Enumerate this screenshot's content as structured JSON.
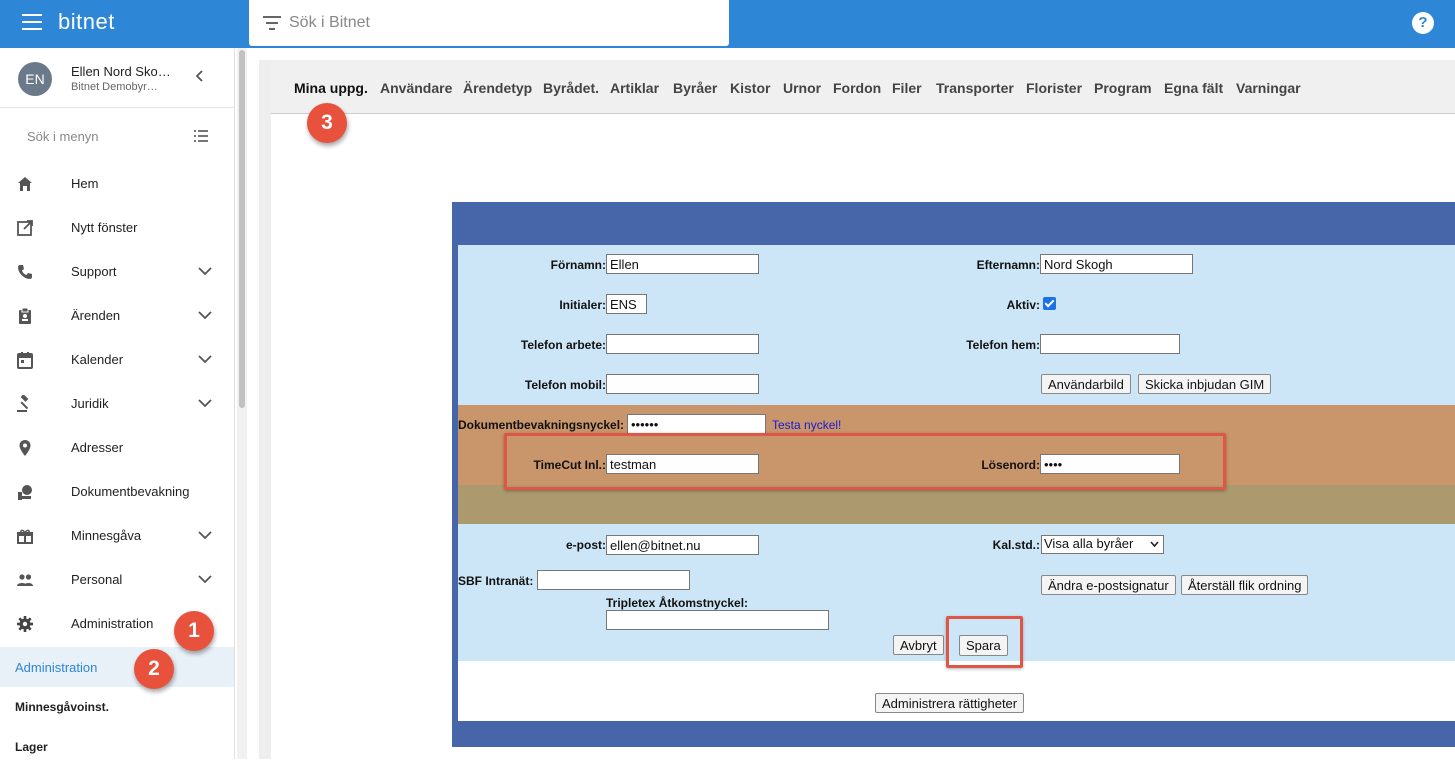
{
  "app": {
    "brand": "bitnet"
  },
  "search": {
    "placeholder": "Sök i Bitnet"
  },
  "user": {
    "initials": "EN",
    "name": "Ellen Nord Sko…",
    "org": "Bitnet Demobyr…"
  },
  "sidebar": {
    "menu_search": "Sök i menyn",
    "items": [
      {
        "label": "Hem",
        "icon": "home-icon",
        "chevron": false
      },
      {
        "label": "Nytt fönster",
        "icon": "open-new-window-icon",
        "chevron": false
      },
      {
        "label": "Support",
        "icon": "phone-icon",
        "chevron": true
      },
      {
        "label": "Ärenden",
        "icon": "clipboard-icon",
        "chevron": true
      },
      {
        "label": "Kalender",
        "icon": "calendar-icon",
        "chevron": true
      },
      {
        "label": "Juridik",
        "icon": "gavel-icon",
        "chevron": true
      },
      {
        "label": "Adresser",
        "icon": "location-pin-icon",
        "chevron": false
      },
      {
        "label": "Dokumentbevakning",
        "icon": "document-watch-icon",
        "chevron": false
      },
      {
        "label": "Minnesgåva",
        "icon": "gift-icon",
        "chevron": true
      },
      {
        "label": "Personal",
        "icon": "people-icon",
        "chevron": true
      },
      {
        "label": "Administration",
        "icon": "gear-icon",
        "chevron": false
      }
    ],
    "sub_items": [
      "Administration",
      "Minnesgåvoinst.",
      "Lager"
    ]
  },
  "tabs": [
    "Mina uppg.",
    "Användare",
    "Ärendetyp",
    "Byrådet.",
    "Artiklar",
    "Byråer",
    "Kistor",
    "Urnor",
    "Fordon",
    "Filer",
    "Transporter",
    "Florister",
    "Program",
    "Egna fält",
    "Varningar"
  ],
  "badges": [
    "1",
    "2",
    "3"
  ],
  "form": {
    "fornamn_label": "Förnamn:",
    "fornamn_value": "Ellen",
    "efternamn_label": "Efternamn:",
    "efternamn_value": "Nord Skogh",
    "initialer_label": "Initialer:",
    "initialer_value": "ENS",
    "aktiv_label": "Aktiv:",
    "aktiv_checked": true,
    "tel_arbete_label": "Telefon arbete:",
    "tel_arbete_value": "",
    "tel_hem_label": "Telefon hem:",
    "tel_hem_value": "",
    "tel_mobil_label": "Telefon mobil:",
    "tel_mobil_value": "",
    "anvandarbild_button": "Användarbild",
    "gim_button": "Skicka inbjudan GIM",
    "dokument_label": "Dokumentbevakningsnyckel:",
    "dokument_value": "••••••",
    "testa_link": "Testa nyckel!",
    "timecut_label": "TimeCut Inl.:",
    "timecut_value": "testman",
    "losenord_label": "Lösenord:",
    "losenord_value": "••••",
    "epost_label": "e-post:",
    "epost_value": "ellen@bitnet.nu",
    "kalstd_label": "Kal.std.:",
    "kalstd_value": "Visa alla byråer",
    "sbf_label": "SBF Intranät:",
    "sbf_value": "",
    "andra_signatur_button": "Ändra e-postsignatur",
    "aterstall_button": "Återställ flik ordning",
    "tripletex_label": "Tripletex Åtkomstnyckel:",
    "tripletex_value": "",
    "avbryt_button": "Avbryt",
    "spara_button": "Spara",
    "rattigheter_button": "Administrera rättigheter"
  },
  "colors": {
    "topbar": "#2e86d6",
    "badge": "#e8513c",
    "panel": "#4766a9",
    "form_bg": "#cde6f7",
    "tan": "#c9956a",
    "olive": "#ac9a6e",
    "highlight": "#e05646"
  }
}
